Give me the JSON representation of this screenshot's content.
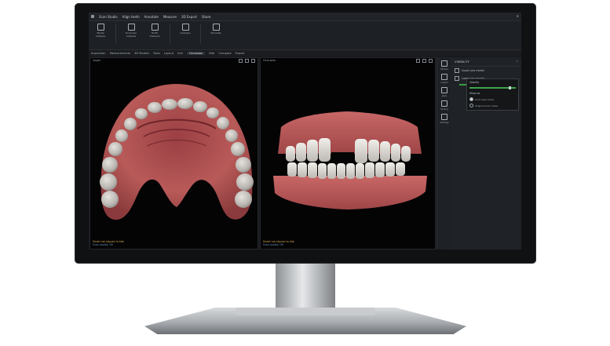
{
  "window": {
    "title": "Scan Studio",
    "menu": [
      "Align teeth",
      "Annotate",
      "Measure",
      "3D Export",
      "Share"
    ]
  },
  "toolbar": {
    "buttons": [
      {
        "label": "Model analysis",
        "icon": "model-analysis-icon"
      },
      {
        "label": "Occlusion analysis",
        "icon": "occlusion-icon"
      },
      {
        "label": "Tooth measure",
        "icon": "measure-icon"
      },
      {
        "label": "Overlays",
        "icon": "overlay-icon"
      },
      {
        "label": "Simulate",
        "icon": "simulate-icon"
      }
    ]
  },
  "tabs": [
    {
      "label": "Inspection",
      "active": false
    },
    {
      "label": "Measurements",
      "active": false
    },
    {
      "label": "3D Models",
      "active": false
    },
    {
      "label": "Tools",
      "active": false
    },
    {
      "label": "Layout",
      "active": false
    },
    {
      "label": "Info",
      "active": false
    },
    {
      "label": "Occlusion",
      "active": true
    },
    {
      "label": "Bite",
      "active": false
    },
    {
      "label": "Compare",
      "active": false
    },
    {
      "label": "Export",
      "active": false
    }
  ],
  "views": {
    "left": {
      "title": "Upper",
      "warning": "Model not aligned to bite",
      "status": "Scan quality: OK"
    },
    "right": {
      "title": "Occlusion",
      "warning": "Model not aligned to bite",
      "status": "Scan quality: OK"
    }
  },
  "sidepanel": {
    "title": "VISIBILITY",
    "items": [
      {
        "label": "Upper jaw model",
        "checked": true
      },
      {
        "label": "Lower jaw model",
        "checked": true
      }
    ],
    "slider_value": 0.85
  },
  "popup": {
    "title": "Opacity",
    "slider_value": 0.8,
    "section": "Show as",
    "options": [
      {
        "label": "Arch view mode",
        "selected": true
      },
      {
        "label": "Original scan mode",
        "selected": false
      }
    ]
  },
  "iconbar": [
    {
      "label": "Models",
      "icon": "models-icon"
    },
    {
      "label": "Layers",
      "icon": "layers-icon"
    },
    {
      "label": "Jaws",
      "icon": "jaws-icon"
    },
    {
      "label": "Tooling",
      "icon": "tooling-icon"
    },
    {
      "label": "Settings",
      "icon": "settings-icon"
    }
  ],
  "colors": {
    "gum": "#b85a58",
    "gum_dark": "#7e2f33",
    "tooth": "#c9c6c1",
    "accent_green": "#3ea449",
    "warning": "#d0a24a"
  }
}
